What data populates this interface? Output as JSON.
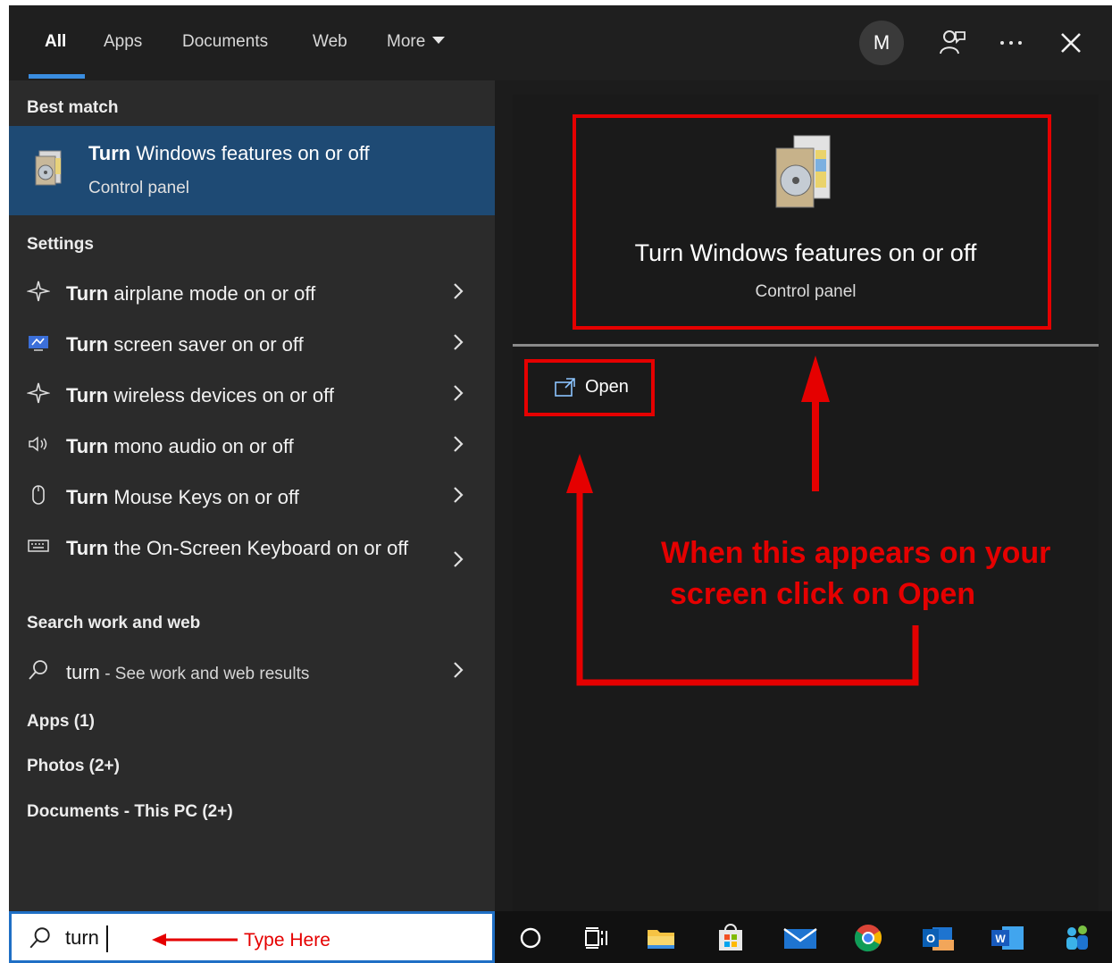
{
  "header": {
    "tabs": [
      {
        "label": "All",
        "active": true
      },
      {
        "label": "Apps"
      },
      {
        "label": "Documents"
      },
      {
        "label": "Web"
      },
      {
        "label": "More"
      }
    ],
    "avatar_initial": "M",
    "icons": [
      "feedback-icon",
      "more-options-icon",
      "close-icon"
    ]
  },
  "left": {
    "best_match_heading": "Best match",
    "best_match": {
      "keyword": "Turn",
      "rest": " Windows features on or off",
      "subtitle": "Control panel",
      "icon": "windows-features-icon"
    },
    "settings_heading": "Settings",
    "settings": [
      {
        "keyword": "Turn",
        "rest": " airplane mode on or off",
        "icon": "airplane-icon"
      },
      {
        "keyword": "Turn",
        "rest": " screen saver on or off",
        "icon": "screen-saver-icon"
      },
      {
        "keyword": "Turn",
        "rest": " wireless devices on or off",
        "icon": "airplane-icon"
      },
      {
        "keyword": "Turn",
        "rest": " mono audio on or off",
        "icon": "speaker-icon"
      },
      {
        "keyword": "Turn",
        "rest": " Mouse Keys on or off",
        "icon": "mouse-icon"
      },
      {
        "keyword": "Turn",
        "rest": " the On-Screen Keyboard on or off",
        "icon": "keyboard-icon"
      }
    ],
    "search_web_heading": "Search work and web",
    "search_web": {
      "query": "turn",
      "suffix": " - See work and web results"
    },
    "apps_heading": "Apps (1)",
    "photos_heading": "Photos (2+)",
    "documents_heading": "Documents - This PC (2+)"
  },
  "search": {
    "value": "turn",
    "annotation": "Type Here"
  },
  "preview": {
    "title": "Turn Windows features on or off",
    "subtitle": "Control panel",
    "open_label": "Open"
  },
  "annotation": {
    "line1": "When this appears on your",
    "line2": "screen click on Open",
    "color": "#e50000"
  },
  "taskbar": {
    "icons": [
      "cortana-icon",
      "task-view-icon",
      "file-explorer-icon",
      "store-icon",
      "mail-icon",
      "chrome-icon",
      "outlook-icon",
      "word-icon",
      "people-icon"
    ]
  },
  "colors": {
    "accent": "#3a8de0",
    "selection": "#1e4a74",
    "annotation": "#e50000"
  }
}
